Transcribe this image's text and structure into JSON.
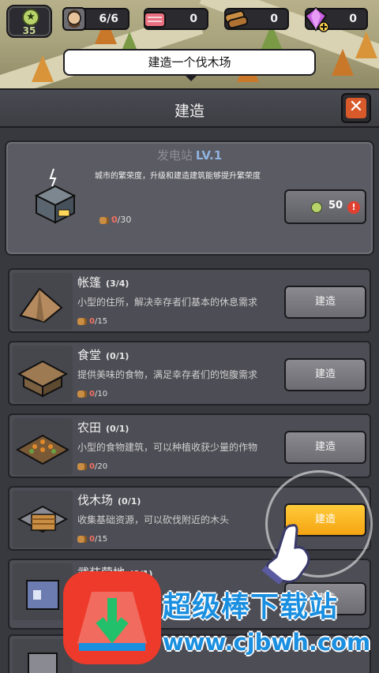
{
  "hud": {
    "level": "35",
    "resources": [
      {
        "name": "survivors-icon",
        "value": "6/6"
      },
      {
        "name": "meat-icon",
        "value": "0"
      },
      {
        "name": "wood-icon",
        "value": "0"
      },
      {
        "name": "gem-icon",
        "value": "0"
      }
    ]
  },
  "tooltip": "建造一个伐木场",
  "panel": {
    "title": "建造",
    "close_icon": "close-icon"
  },
  "featured": {
    "title": "发电站",
    "level": "LV.1",
    "description": "城市的繁荣度，升级和建造建筑能够提升繁荣度",
    "cost_current": "0",
    "cost_required": "/30",
    "button_value": "50",
    "warning": "!"
  },
  "buildings": [
    {
      "name": "帐篷",
      "count": "(3/4)",
      "desc": "小型的住所，解决幸存者们基本的休息需求",
      "cost_current": "0",
      "cost_required": "/15",
      "button": "建造",
      "highlight": false
    },
    {
      "name": "食堂",
      "count": "(0/1)",
      "desc": "提供美味的食物，满足幸存者们的饱腹需求",
      "cost_current": "0",
      "cost_required": "/10",
      "button": "建造",
      "highlight": false
    },
    {
      "name": "农田",
      "count": "(0/1)",
      "desc": "小型的食物建筑，可以种植收获少量的作物",
      "cost_current": "0",
      "cost_required": "/20",
      "button": "建造",
      "highlight": false
    },
    {
      "name": "伐木场",
      "count": "(0/1)",
      "desc": "收集基础资源，可以砍伐附近的木头",
      "cost_current": "0",
      "cost_required": "/15",
      "button": "建造",
      "highlight": true
    },
    {
      "name": "武装营地",
      "count": "(0/1)",
      "desc": "",
      "cost_current": "",
      "cost_required": "",
      "button": "建造",
      "highlight": false
    }
  ],
  "watermark": {
    "title": "超级棒下载站",
    "url": "www.cjbwh.com"
  },
  "colors": {
    "accent": "#f5a512",
    "panel": "#4d4d55",
    "warning": "#e04030",
    "watermark": "#1a8fe0"
  }
}
